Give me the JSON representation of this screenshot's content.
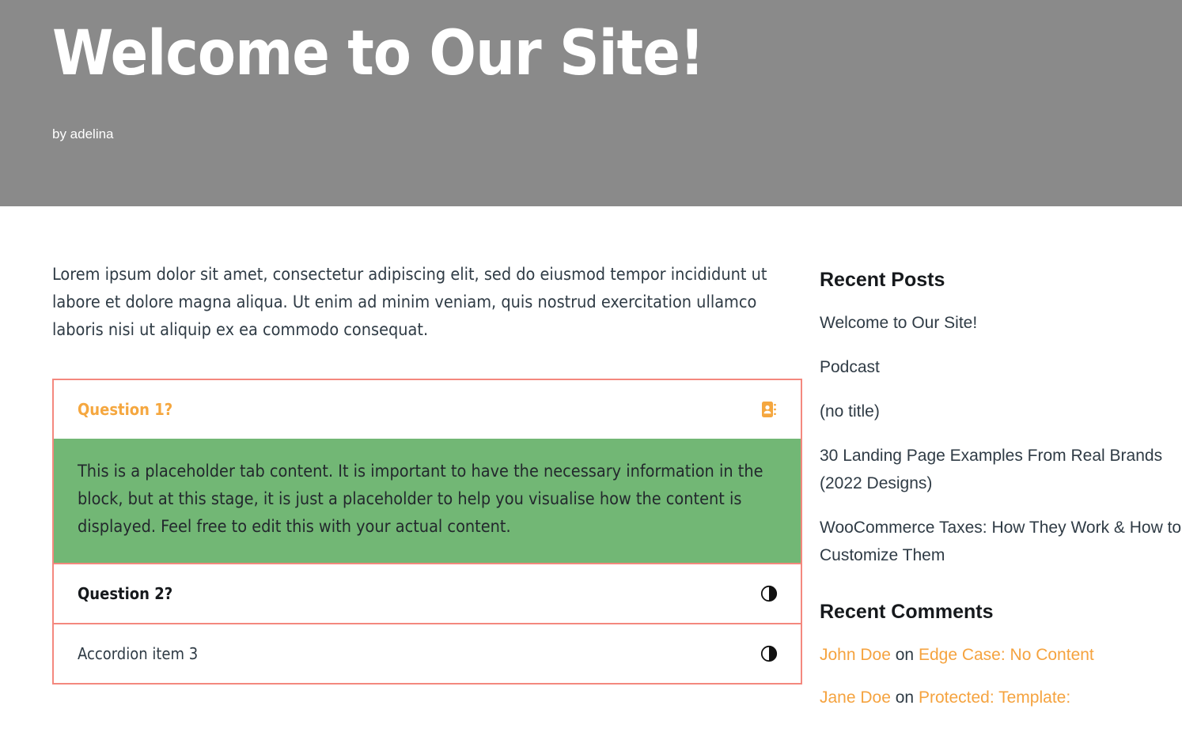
{
  "header": {
    "title": "Welcome to Our Site!",
    "byline": "by adelina",
    "background_color": "#8a8a8a",
    "title_color": "#ffffff"
  },
  "main": {
    "intro_paragraph": "Lorem ipsum dolor sit amet, consectetur adipiscing elit, sed do eiusmod tempor incididunt ut labore et dolore magna aliqua. Ut enim ad minim veniam, quis nostrud exercitation ullamco laboris nisi ut aliquip ex ea commodo consequat.",
    "accordion": {
      "border_color": "#f4887e",
      "open_panel_color": "#72b775",
      "active_title_color": "#f5a73f",
      "items": [
        {
          "title": "Question 1?",
          "icon": "address-book-icon",
          "expanded": true,
          "panel_text": "This is a placeholder tab content. It is important to have the necessary information in the block, but at this stage, it is just a placeholder to help you visualise how the content is displayed. Feel free to edit this with your actual content."
        },
        {
          "title": "Question 2?",
          "icon": "contrast-circle-icon",
          "expanded": false,
          "panel_text": ""
        },
        {
          "title": "Accordion item 3",
          "icon": "contrast-circle-icon",
          "expanded": false,
          "panel_text": ""
        }
      ]
    }
  },
  "sidebar": {
    "recent_posts": {
      "title": "Recent Posts",
      "items": [
        "Welcome to Our Site!",
        "Podcast",
        "(no title)",
        "30 Landing Page Examples From Real Brands (2022 Designs)",
        "WooCommerce Taxes: How They Work & How to Customize Them"
      ]
    },
    "recent_comments": {
      "title": "Recent Comments",
      "link_color": "#f5a33f",
      "items": [
        {
          "author": "John Doe",
          "on": "on",
          "post": "Edge Case: No Content"
        },
        {
          "author": "Jane Doe",
          "on": "on",
          "post": "Protected: Template:"
        }
      ]
    }
  }
}
